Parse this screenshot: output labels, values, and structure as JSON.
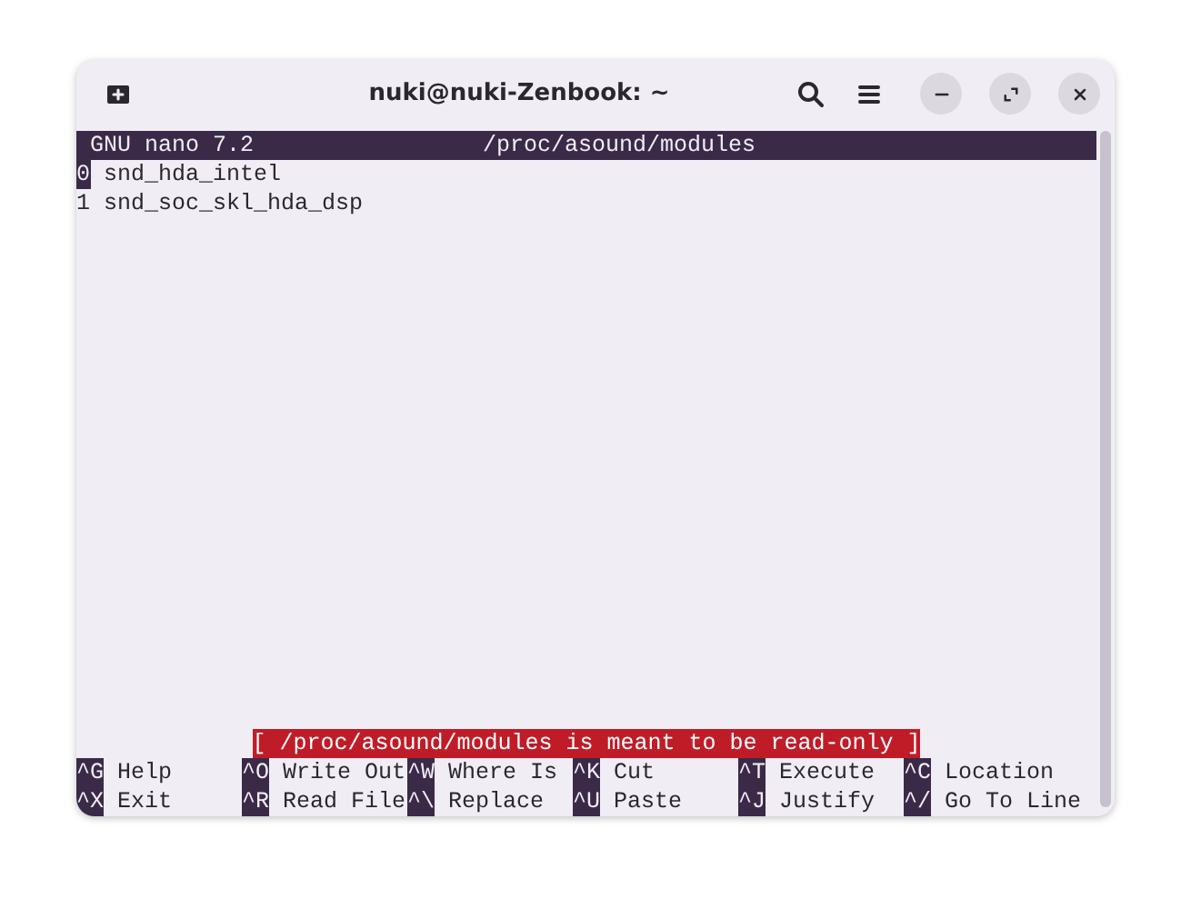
{
  "window": {
    "title": "nuki@nuki-Zenbook: ~"
  },
  "nano": {
    "version": "GNU nano 7.2",
    "file": "/proc/asound/modules"
  },
  "lines": [
    {
      "text": "0 snd_hda_intel",
      "cursor": true
    },
    {
      "text": "1 snd_soc_skl_hda_dsp",
      "cursor": false
    }
  ],
  "status": "[ /proc/asound/modules is meant to be read-only ]",
  "shortcuts": [
    [
      {
        "key": "^G",
        "label": "Help"
      },
      {
        "key": "^O",
        "label": "Write Out"
      },
      {
        "key": "^W",
        "label": "Where Is"
      },
      {
        "key": "^K",
        "label": "Cut"
      },
      {
        "key": "^T",
        "label": "Execute"
      },
      {
        "key": "^C",
        "label": "Location"
      }
    ],
    [
      {
        "key": "^X",
        "label": "Exit"
      },
      {
        "key": "^R",
        "label": "Read File"
      },
      {
        "key": "^\\",
        "label": "Replace"
      },
      {
        "key": "^U",
        "label": "Paste"
      },
      {
        "key": "^J",
        "label": "Justify"
      },
      {
        "key": "^/",
        "label": "Go To Line"
      }
    ]
  ]
}
